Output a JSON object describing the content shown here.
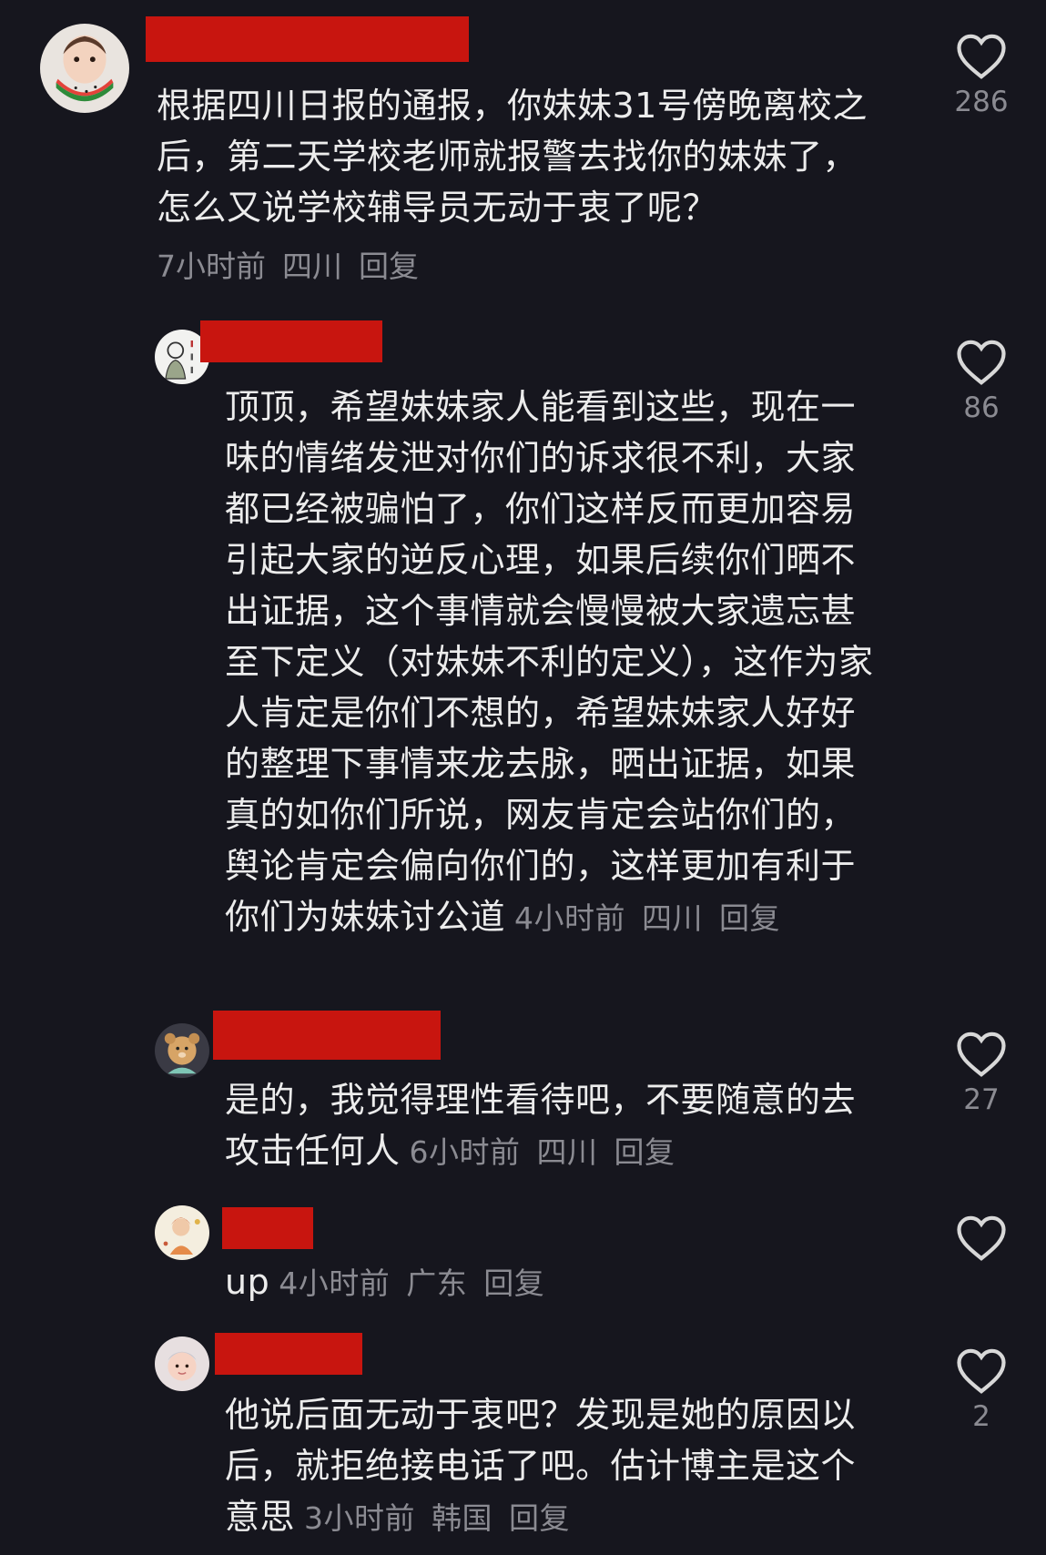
{
  "comments": [
    {
      "text": "根据四川日报的通报，你妹妹31号傍晚离校之后，第二天学校老师就报警去找你的妹妹了，怎么又说学校辅导员无动于衷了呢？",
      "time": "7小时前",
      "location": "四川",
      "reply": "回复",
      "likes": "286"
    },
    {
      "text": "顶顶，希望妹妹家人能看到这些，现在一味的情绪发泄对你们的诉求很不利，大家都已经被骗怕了，你们这样反而更加容易引起大家的逆反心理，如果后续你们晒不出证据，这个事情就会慢慢被大家遗忘甚至下定义（对妹妹不利的定义），这作为家人肯定是你们不想的，希望妹妹家人好好的整理下事情来龙去脉，晒出证据，如果真的如你们所说，网友肯定会站你们的，舆论肯定会偏向你们的，这样更加有利于你们为妹妹讨公道",
      "time": "4小时前",
      "location": "四川",
      "reply": "回复",
      "likes": "86"
    },
    {
      "text": "是的，我觉得理性看待吧，不要随意的去攻击任何人",
      "time": "6小时前",
      "location": "四川",
      "reply": "回复",
      "likes": "27"
    },
    {
      "text": "up",
      "time": "4小时前",
      "location": "广东",
      "reply": "回复",
      "likes": ""
    },
    {
      "text": "他说后面无动于衷吧？发现是她的原因以后，就拒绝接电话了吧。估计博主是这个意思",
      "time": "3小时前",
      "location": "韩国",
      "reply": "回复",
      "likes": "2"
    }
  ],
  "colors": {
    "background": "#16161e",
    "text": "#ececec",
    "meta": "#8b8b92",
    "redaction": "#c8150f"
  },
  "icons": {
    "like": "heart-outline-icon"
  }
}
